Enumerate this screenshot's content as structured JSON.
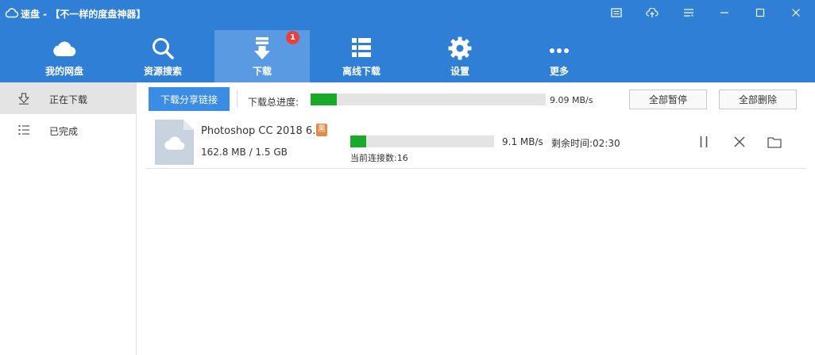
{
  "window": {
    "title": "速盘 - 【不一样的度盘神器】",
    "controls": [
      "menu-icon",
      "upload-icon",
      "list-icon",
      "minimize-icon",
      "maximize-icon",
      "close-icon"
    ]
  },
  "toolbar": {
    "items": [
      {
        "label": "我的网盘",
        "icon": "cloud-icon"
      },
      {
        "label": "资源搜索",
        "icon": "search-icon"
      },
      {
        "label": "下载",
        "icon": "download-icon",
        "badge": "1"
      },
      {
        "label": "离线下载",
        "icon": "grid-list-icon"
      },
      {
        "label": "设置",
        "icon": "gear-icon"
      },
      {
        "label": "更多",
        "icon": "more-icon"
      }
    ],
    "active_index": 2
  },
  "sidebar": {
    "items": [
      {
        "label": "正在下载",
        "icon": "download-arrow-icon"
      },
      {
        "label": "已完成",
        "icon": "list-icon"
      }
    ],
    "active_index": 0
  },
  "actions": {
    "download_share_link": "下载分享链接",
    "total_progress_label": "下载总进度:",
    "total_progress": 0.11,
    "total_speed": "9.09 MB/s",
    "pause_all": "全部暂停",
    "delete_all": "全部删除"
  },
  "downloads": [
    {
      "name": "Photoshop CC 2018 6...",
      "tag": "黑",
      "size": "162.8 MB / 1.5 GB",
      "progress": 0.11,
      "speed": "9.1 MB/s",
      "remaining": "剩余时间:02:30",
      "connections": "当前连接数:16"
    }
  ],
  "colors": {
    "accent": "#2f7fd6",
    "active_tab": "#5a9ae3",
    "progress": "#1aaa2a",
    "badge": "#e8413c",
    "tag": "#e08a4a"
  }
}
